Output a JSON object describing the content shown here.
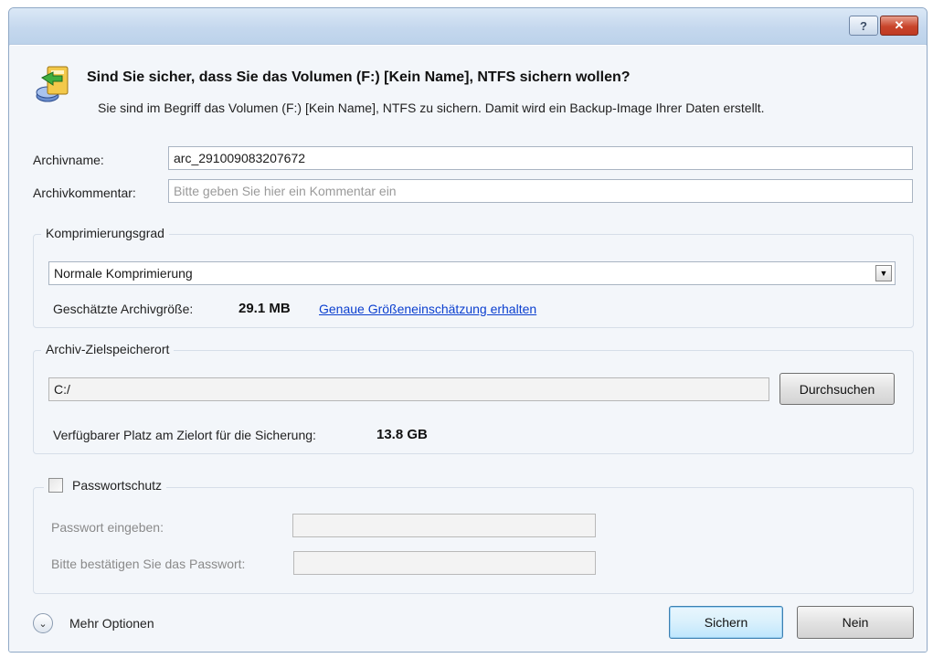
{
  "window": {
    "help_label": "?",
    "close_label": "✕"
  },
  "header": {
    "title": "Sind Sie sicher, dass Sie das Volumen (F:) [Kein Name], NTFS sichern wollen?",
    "description": "Sie sind im Begriff das Volumen (F:) [Kein Name], NTFS zu sichern. Damit wird ein Backup-Image Ihrer Daten erstellt."
  },
  "archive": {
    "name_label": "Archivname:",
    "name_value": "arc_291009083207672",
    "comment_label": "Archivkommentar:",
    "comment_placeholder": "Bitte geben Sie hier ein Kommentar ein"
  },
  "compression": {
    "group_title": "Komprimierungsgrad",
    "selected": "Normale Komprimierung",
    "size_label": "Geschätzte Archivgröße:",
    "size_value": "29.1 MB",
    "estimate_link": "Genaue Größeneinschätzung erhalten"
  },
  "destination": {
    "group_title": "Archiv-Zielspeicherort",
    "path": "C:/",
    "browse_label": "Durchsuchen",
    "space_label": "Verfügbarer Platz am Zielort für die Sicherung:",
    "space_value": "13.8 GB"
  },
  "password": {
    "checkbox_label": "Passwortschutz",
    "checked": false,
    "enter_label": "Passwort eingeben:",
    "confirm_label": "Bitte bestätigen Sie das Passwort:"
  },
  "footer": {
    "more_options_label": "Mehr Optionen",
    "ok_label": "Sichern",
    "cancel_label": "Nein"
  }
}
